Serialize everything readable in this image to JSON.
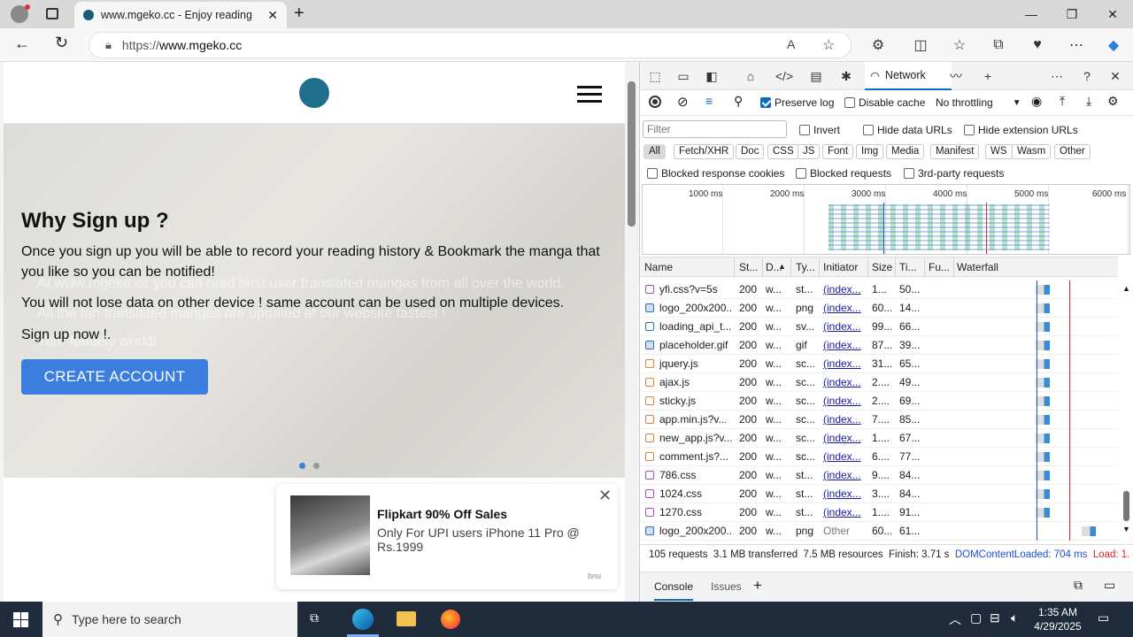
{
  "browser": {
    "tab_title": "www.mgeko.cc - Enjoy reading",
    "new_tab": "+",
    "url_prefix": "https://",
    "url_host": "www.mgeko.cc"
  },
  "site": {
    "hero": {
      "ghost1": "At www.mgeko.cc you can read best user translated mangas from all over the world.",
      "ghost2": "All the fan translated mangas are updated at our website fastest !",
      "ghost3": "Your fantasy world!",
      "heading": "Why Sign up ?",
      "p1": "Once you sign up you will be able to record your reading history & Bookmark the manga that you like so you can be notified!",
      "p2": "You will not lose data on other device ! same account can be used on multiple devices.",
      "p3": "Sign up now !.",
      "cta": "CREATE ACCOUNT"
    },
    "ad": {
      "title": "Flipkart 90% Off Sales",
      "text": "Only For UPI users iPhone 11 Pro @ Rs.1999",
      "brand": "bnu"
    }
  },
  "devtools": {
    "network_tab": "Network",
    "toolbar": {
      "preserve_log": "Preserve log",
      "disable_cache": "Disable cache",
      "throttling": "No throttling"
    },
    "filter": {
      "placeholder": "Filter",
      "invert": "Invert",
      "hide_data_urls": "Hide data URLs",
      "hide_extension_urls": "Hide extension URLs"
    },
    "types": [
      "All",
      "Fetch/XHR",
      "Doc",
      "CSS",
      "JS",
      "Font",
      "Img",
      "Media",
      "Manifest",
      "WS",
      "Wasm",
      "Other"
    ],
    "blocks": {
      "blocked_response_cookies": "Blocked response cookies",
      "blocked_requests": "Blocked requests",
      "third_party": "3rd-party requests"
    },
    "overview_ticks": [
      "1000 ms",
      "2000 ms",
      "3000 ms",
      "4000 ms",
      "5000 ms",
      "6000 ms"
    ],
    "columns": {
      "name": "Name",
      "status": "St...",
      "domain": "D...",
      "type": "Ty...",
      "initiator": "Initiator",
      "size": "Size",
      "time": "Ti...",
      "fulfilled": "Fu...",
      "waterfall": "Waterfall"
    },
    "rows": [
      {
        "name": "yfi.css?v=5s",
        "status": "200",
        "domain": "w...",
        "type": "st...",
        "initiator": "(index...",
        "size": "1...",
        "time": "50...",
        "icon": "css",
        "wf": 0.56
      },
      {
        "name": "logo_200x200...",
        "status": "200",
        "domain": "w...",
        "type": "png",
        "initiator": "(index...",
        "size": "60...",
        "time": "14...",
        "icon": "img",
        "wf": 0.56
      },
      {
        "name": "loading_api_t...",
        "status": "200",
        "domain": "w...",
        "type": "sv...",
        "initiator": "(index...",
        "size": "99...",
        "time": "66...",
        "icon": "svg",
        "wf": 0.56
      },
      {
        "name": "placeholder.gif",
        "status": "200",
        "domain": "w...",
        "type": "gif",
        "initiator": "(index...",
        "size": "87...",
        "time": "39...",
        "icon": "gif",
        "wf": 0.56
      },
      {
        "name": "jquery.js",
        "status": "200",
        "domain": "w...",
        "type": "sc...",
        "initiator": "(index...",
        "size": "31...",
        "time": "65...",
        "icon": "js",
        "wf": 0.56
      },
      {
        "name": "ajax.js",
        "status": "200",
        "domain": "w...",
        "type": "sc...",
        "initiator": "(index...",
        "size": "2....",
        "time": "49...",
        "icon": "js",
        "wf": 0.56
      },
      {
        "name": "sticky.js",
        "status": "200",
        "domain": "w...",
        "type": "sc...",
        "initiator": "(index...",
        "size": "2....",
        "time": "69...",
        "icon": "js",
        "wf": 0.56
      },
      {
        "name": "app.min.js?v...",
        "status": "200",
        "domain": "w...",
        "type": "sc...",
        "initiator": "(index...",
        "size": "7....",
        "time": "85...",
        "icon": "js",
        "wf": 0.56
      },
      {
        "name": "new_app.js?v...",
        "status": "200",
        "domain": "w...",
        "type": "sc...",
        "initiator": "(index...",
        "size": "1....",
        "time": "67...",
        "icon": "js",
        "wf": 0.56
      },
      {
        "name": "comment.js?...",
        "status": "200",
        "domain": "w...",
        "type": "sc...",
        "initiator": "(index...",
        "size": "6....",
        "time": "77...",
        "icon": "js",
        "wf": 0.56
      },
      {
        "name": "786.css",
        "status": "200",
        "domain": "w...",
        "type": "st...",
        "initiator": "(index...",
        "size": "9....",
        "time": "84...",
        "icon": "css",
        "wf": 0.56
      },
      {
        "name": "1024.css",
        "status": "200",
        "domain": "w...",
        "type": "st...",
        "initiator": "(index...",
        "size": "3....",
        "time": "84...",
        "icon": "css",
        "wf": 0.56
      },
      {
        "name": "1270.css",
        "status": "200",
        "domain": "w...",
        "type": "st...",
        "initiator": "(index...",
        "size": "1....",
        "time": "91...",
        "icon": "css",
        "wf": 0.56
      },
      {
        "name": "logo_200x200...",
        "status": "200",
        "domain": "w...",
        "type": "png",
        "initiator": "Other",
        "size": "60...",
        "time": "61...",
        "icon": "img",
        "wf": 0.85
      }
    ],
    "status": {
      "requests": "105 requests",
      "transferred": "3.1 MB transferred",
      "resources": "7.5 MB resources",
      "finish": "Finish: 3.71 s",
      "dom": "DOMContentLoaded: 704 ms",
      "load": "Load: 1."
    },
    "drawer": {
      "console": "Console",
      "issues": "Issues"
    }
  },
  "taskbar": {
    "search_placeholder": "Type here to search",
    "time": "1:35 AM",
    "date": "4/29/2025"
  },
  "colors": {
    "accent": "#0f6cbd",
    "cta": "#3c7de0",
    "dom_line": "#1b4fd4",
    "load_line": "#dd2222"
  }
}
